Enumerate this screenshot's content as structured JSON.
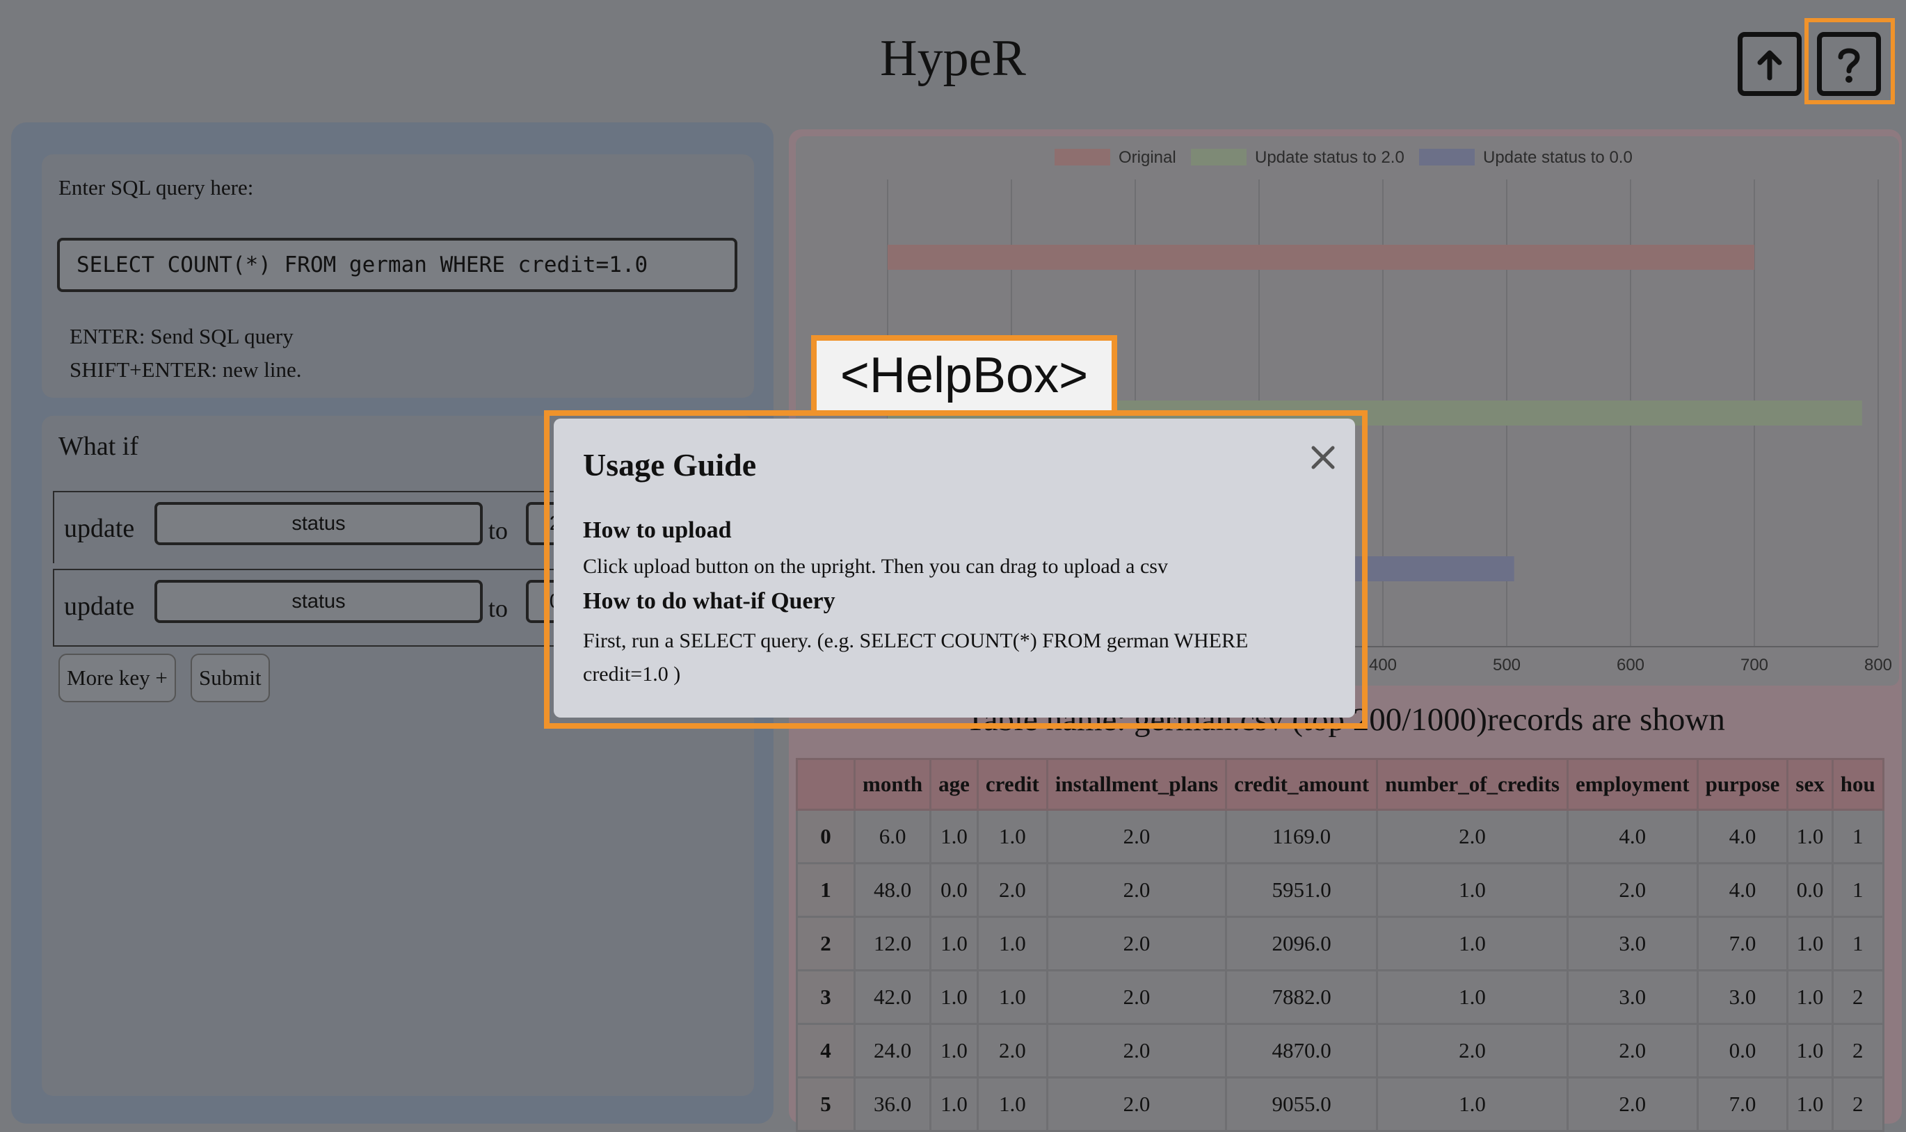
{
  "app": {
    "title": "HypeR"
  },
  "header": {
    "upload_icon": "upload-icon",
    "help_icon": "help-question-icon"
  },
  "sql": {
    "prompt": "Enter SQL query here:",
    "query": "SELECT COUNT(*) FROM german WHERE credit=1.0",
    "hint_enter": "ENTER: Send SQL query",
    "hint_shift_enter": "SHIFT+ENTER: new line."
  },
  "whatif": {
    "title": "What if",
    "rows": [
      {
        "update_label": "update",
        "attribute": "status",
        "to_label": "to",
        "value_partial": "2"
      },
      {
        "update_label": "update",
        "attribute": "status",
        "to_label": "to",
        "value_partial": "0"
      }
    ],
    "more_key_label": "More key +",
    "submit_label": "Submit"
  },
  "chart_data": {
    "type": "bar",
    "orientation": "horizontal",
    "series": [
      {
        "name": "Original",
        "value": 700,
        "color": "#8e6f6f"
      },
      {
        "name": "Update status to 2.0",
        "value": 787,
        "color": "#7e8a76"
      },
      {
        "name": "Update status to 0.0",
        "value": 506,
        "color": "#6c7088"
      }
    ],
    "xlim": [
      0,
      800
    ],
    "x_ticks_visible": [
      "400",
      "500",
      "600",
      "700",
      "800"
    ],
    "grid": true,
    "legend_position": "top"
  },
  "table": {
    "title": "Table name: german.csv (top 200/1000)records are shown",
    "columns": [
      "",
      "month",
      "age",
      "credit",
      "installment_plans",
      "credit_amount",
      "number_of_credits",
      "employment",
      "purpose",
      "sex",
      "hou"
    ],
    "rows": [
      [
        "0",
        "6.0",
        "1.0",
        "1.0",
        "2.0",
        "1169.0",
        "2.0",
        "4.0",
        "4.0",
        "1.0",
        "1"
      ],
      [
        "1",
        "48.0",
        "0.0",
        "2.0",
        "2.0",
        "5951.0",
        "1.0",
        "2.0",
        "4.0",
        "0.0",
        "1"
      ],
      [
        "2",
        "12.0",
        "1.0",
        "1.0",
        "2.0",
        "2096.0",
        "1.0",
        "3.0",
        "7.0",
        "1.0",
        "1"
      ],
      [
        "3",
        "42.0",
        "1.0",
        "1.0",
        "2.0",
        "7882.0",
        "1.0",
        "3.0",
        "3.0",
        "1.0",
        "2"
      ],
      [
        "4",
        "24.0",
        "1.0",
        "2.0",
        "2.0",
        "4870.0",
        "2.0",
        "2.0",
        "0.0",
        "1.0",
        "2"
      ],
      [
        "5",
        "36.0",
        "1.0",
        "1.0",
        "2.0",
        "9055.0",
        "1.0",
        "2.0",
        "7.0",
        "1.0",
        "2"
      ]
    ]
  },
  "helpbox": {
    "tag": "<HelpBox>",
    "title": "Usage Guide",
    "close_icon": "close-icon",
    "section1_title": "How to upload",
    "section1_text": "Click upload button on the upright. Then you can drag to upload a csv",
    "section2_title": "How to do what-if Query",
    "section2_text": "First, run a SELECT query. (e.g. SELECT COUNT(*) FROM german WHERE credit=1.0 )"
  }
}
